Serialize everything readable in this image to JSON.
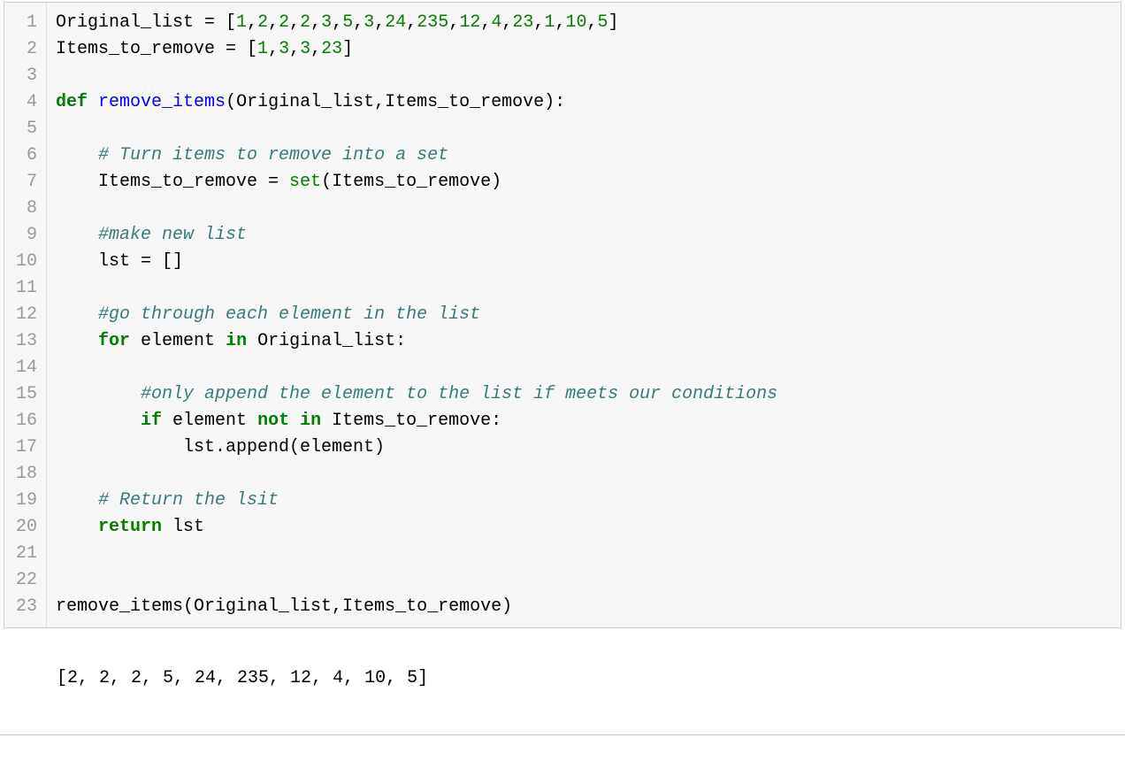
{
  "gutter": [
    "1",
    "2",
    "3",
    "4",
    "5",
    "6",
    "7",
    "8",
    "9",
    "10",
    "11",
    "12",
    "13",
    "14",
    "15",
    "16",
    "17",
    "18",
    "19",
    "20",
    "21",
    "22",
    "23"
  ],
  "code": {
    "lines": [
      {
        "tokens": [
          {
            "cls": "tok-default",
            "text": "Original_list = ["
          },
          {
            "cls": "tok-number",
            "text": "1"
          },
          {
            "cls": "tok-default",
            "text": ","
          },
          {
            "cls": "tok-number",
            "text": "2"
          },
          {
            "cls": "tok-default",
            "text": ","
          },
          {
            "cls": "tok-number",
            "text": "2"
          },
          {
            "cls": "tok-default",
            "text": ","
          },
          {
            "cls": "tok-number",
            "text": "2"
          },
          {
            "cls": "tok-default",
            "text": ","
          },
          {
            "cls": "tok-number",
            "text": "3"
          },
          {
            "cls": "tok-default",
            "text": ","
          },
          {
            "cls": "tok-number",
            "text": "5"
          },
          {
            "cls": "tok-default",
            "text": ","
          },
          {
            "cls": "tok-number",
            "text": "3"
          },
          {
            "cls": "tok-default",
            "text": ","
          },
          {
            "cls": "tok-number",
            "text": "24"
          },
          {
            "cls": "tok-default",
            "text": ","
          },
          {
            "cls": "tok-number",
            "text": "235"
          },
          {
            "cls": "tok-default",
            "text": ","
          },
          {
            "cls": "tok-number",
            "text": "12"
          },
          {
            "cls": "tok-default",
            "text": ","
          },
          {
            "cls": "tok-number",
            "text": "4"
          },
          {
            "cls": "tok-default",
            "text": ","
          },
          {
            "cls": "tok-number",
            "text": "23"
          },
          {
            "cls": "tok-default",
            "text": ","
          },
          {
            "cls": "tok-number",
            "text": "1"
          },
          {
            "cls": "tok-default",
            "text": ","
          },
          {
            "cls": "tok-number",
            "text": "10"
          },
          {
            "cls": "tok-default",
            "text": ","
          },
          {
            "cls": "tok-number",
            "text": "5"
          },
          {
            "cls": "tok-default",
            "text": "]"
          }
        ]
      },
      {
        "tokens": [
          {
            "cls": "tok-default",
            "text": "Items_to_remove = ["
          },
          {
            "cls": "tok-number",
            "text": "1"
          },
          {
            "cls": "tok-default",
            "text": ","
          },
          {
            "cls": "tok-number",
            "text": "3"
          },
          {
            "cls": "tok-default",
            "text": ","
          },
          {
            "cls": "tok-number",
            "text": "3"
          },
          {
            "cls": "tok-default",
            "text": ","
          },
          {
            "cls": "tok-number",
            "text": "23"
          },
          {
            "cls": "tok-default",
            "text": "]"
          }
        ]
      },
      {
        "tokens": [
          {
            "cls": "tok-default",
            "text": ""
          }
        ]
      },
      {
        "tokens": [
          {
            "cls": "tok-keyword",
            "text": "def"
          },
          {
            "cls": "tok-default",
            "text": " "
          },
          {
            "cls": "tok-funcdef",
            "text": "remove_items"
          },
          {
            "cls": "tok-default",
            "text": "(Original_list,Items_to_remove):"
          }
        ]
      },
      {
        "tokens": [
          {
            "cls": "tok-default",
            "text": ""
          }
        ]
      },
      {
        "tokens": [
          {
            "cls": "tok-default",
            "text": "    "
          },
          {
            "cls": "tok-comment",
            "text": "# Turn items to remove into a set"
          }
        ]
      },
      {
        "tokens": [
          {
            "cls": "tok-default",
            "text": "    Items_to_remove = "
          },
          {
            "cls": "tok-builtin",
            "text": "set"
          },
          {
            "cls": "tok-default",
            "text": "(Items_to_remove)"
          }
        ]
      },
      {
        "tokens": [
          {
            "cls": "tok-default",
            "text": ""
          }
        ]
      },
      {
        "tokens": [
          {
            "cls": "tok-default",
            "text": "    "
          },
          {
            "cls": "tok-comment",
            "text": "#make new list"
          }
        ]
      },
      {
        "tokens": [
          {
            "cls": "tok-default",
            "text": "    lst = []"
          }
        ]
      },
      {
        "tokens": [
          {
            "cls": "tok-default",
            "text": ""
          }
        ]
      },
      {
        "tokens": [
          {
            "cls": "tok-default",
            "text": "    "
          },
          {
            "cls": "tok-comment",
            "text": "#go through each element in the list"
          }
        ]
      },
      {
        "tokens": [
          {
            "cls": "tok-default",
            "text": "    "
          },
          {
            "cls": "tok-keyword",
            "text": "for"
          },
          {
            "cls": "tok-default",
            "text": " element "
          },
          {
            "cls": "tok-keyword",
            "text": "in"
          },
          {
            "cls": "tok-default",
            "text": " Original_list:"
          }
        ]
      },
      {
        "tokens": [
          {
            "cls": "tok-default",
            "text": ""
          }
        ]
      },
      {
        "tokens": [
          {
            "cls": "tok-default",
            "text": "        "
          },
          {
            "cls": "tok-comment",
            "text": "#only append the element to the list if meets our conditions"
          }
        ]
      },
      {
        "tokens": [
          {
            "cls": "tok-default",
            "text": "        "
          },
          {
            "cls": "tok-keyword",
            "text": "if"
          },
          {
            "cls": "tok-default",
            "text": " element "
          },
          {
            "cls": "tok-keyword",
            "text": "not"
          },
          {
            "cls": "tok-default",
            "text": " "
          },
          {
            "cls": "tok-keyword",
            "text": "in"
          },
          {
            "cls": "tok-default",
            "text": " Items_to_remove:"
          }
        ]
      },
      {
        "tokens": [
          {
            "cls": "tok-default",
            "text": "            lst.append(element)"
          }
        ]
      },
      {
        "tokens": [
          {
            "cls": "tok-default",
            "text": ""
          }
        ]
      },
      {
        "tokens": [
          {
            "cls": "tok-default",
            "text": "    "
          },
          {
            "cls": "tok-comment",
            "text": "# Return the lsit"
          }
        ]
      },
      {
        "tokens": [
          {
            "cls": "tok-default",
            "text": "    "
          },
          {
            "cls": "tok-keyword",
            "text": "return"
          },
          {
            "cls": "tok-default",
            "text": " lst"
          }
        ]
      },
      {
        "tokens": [
          {
            "cls": "tok-default",
            "text": ""
          }
        ]
      },
      {
        "tokens": [
          {
            "cls": "tok-default",
            "text": ""
          }
        ]
      },
      {
        "tokens": [
          {
            "cls": "tok-default",
            "text": "remove_items(Original_list,Items_to_remove)"
          }
        ]
      }
    ]
  },
  "output": "[2, 2, 2, 5, 24, 235, 12, 4, 10, 5]"
}
